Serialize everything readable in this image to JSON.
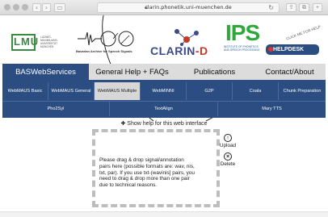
{
  "browser": {
    "url": "clarin.phonetik.uni-muenchen.de",
    "back_glyph": "‹",
    "forward_glyph": "›"
  },
  "logos": {
    "lmu": "LMU",
    "lmu_sub": "LUDWIG-MAXIMILIANS-UNIVERSITÄT MÜNCHEN",
    "bas_caption": "Bavarian Archive for Speech Signals",
    "clarin_main": "CLARIN",
    "clarin_d": "-D",
    "ips": "IPS",
    "ips_caption_1": "INSTITUTE OF PHONETICS",
    "ips_caption_2": "AND SPEECH PROCESSING",
    "helpdesk": "HELPDESK",
    "click_me": "CLICK ME FOR HELP"
  },
  "main_nav": [
    {
      "label": "BASWebServices",
      "active": true
    },
    {
      "label": "General Help + FAQs",
      "active": false
    },
    {
      "label": "Publications",
      "active": false
    },
    {
      "label": "Contact/About",
      "active": false
    }
  ],
  "sub_nav_row1": [
    {
      "label": "WebMAUS Basic",
      "active": false
    },
    {
      "label": "WebMAUS General",
      "active": false
    },
    {
      "label": "WebMAUS Multiple",
      "active": true
    },
    {
      "label": "WebMINNI",
      "active": false
    },
    {
      "label": "G2P",
      "active": false
    },
    {
      "label": "Coala",
      "active": false
    },
    {
      "label": "Chunk Preparation",
      "active": false
    }
  ],
  "sub_nav_row2": [
    {
      "label": "Pho2Syl"
    },
    {
      "label": "TextAlign"
    },
    {
      "label": "Mary TTS"
    }
  ],
  "help_toggle": {
    "icon": "✚",
    "label": "Show help for this web interface"
  },
  "drop_area": {
    "instructions": "Please drag & drop signal/annotation pairs here (possible formats are: wav, nis, txt, par). If you use txt-(wavinis] pairs, you need to drag & drop more than one pair due to technical reasons."
  },
  "tools": {
    "upload_label": "Upload",
    "delete_label": "Delete"
  }
}
